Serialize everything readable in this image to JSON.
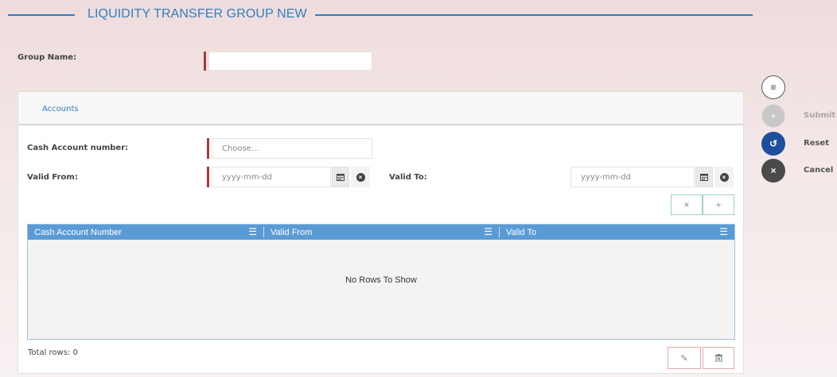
{
  "header": {
    "title": "LIQUIDITY TRANSFER GROUP NEW"
  },
  "form": {
    "group_name_label": "Group Name:",
    "group_name_value": ""
  },
  "tabs": [
    {
      "label": "Accounts"
    }
  ],
  "accounts": {
    "cash_account_label": "Cash Account number:",
    "cash_account_placeholder": "Choose...",
    "valid_from_label": "Valid From:",
    "valid_from_placeholder": "yyyy-mm-dd",
    "valid_to_label": "Valid To:",
    "valid_to_placeholder": "yyyy-mm-dd",
    "clear_button": "×",
    "add_button": "+"
  },
  "table": {
    "columns": [
      "Cash Account Number",
      "Valid From",
      "Valid To"
    ],
    "empty_text": "No Rows To Show",
    "total_rows": "Total rows: 0",
    "edit_icon": "✎",
    "delete_icon": "🗑"
  },
  "side_actions": {
    "menu_icon": "≡",
    "submit_icon": "+",
    "submit_label": "Submit",
    "reset_icon": "↺",
    "reset_label": "Reset",
    "cancel_icon": "×",
    "cancel_label": "Cancel"
  },
  "icons": {
    "calendar": "calendar-icon",
    "clear": "clear-icon",
    "column_menu": "menu-icon"
  },
  "colors": {
    "accent": "#2f7fc1",
    "required": "#a83a3a",
    "grid_header": "#5b9bd5",
    "reset_button": "#1f4e9c",
    "cancel_button": "#4a4a4a",
    "submit_disabled": "#c7c7c7"
  }
}
